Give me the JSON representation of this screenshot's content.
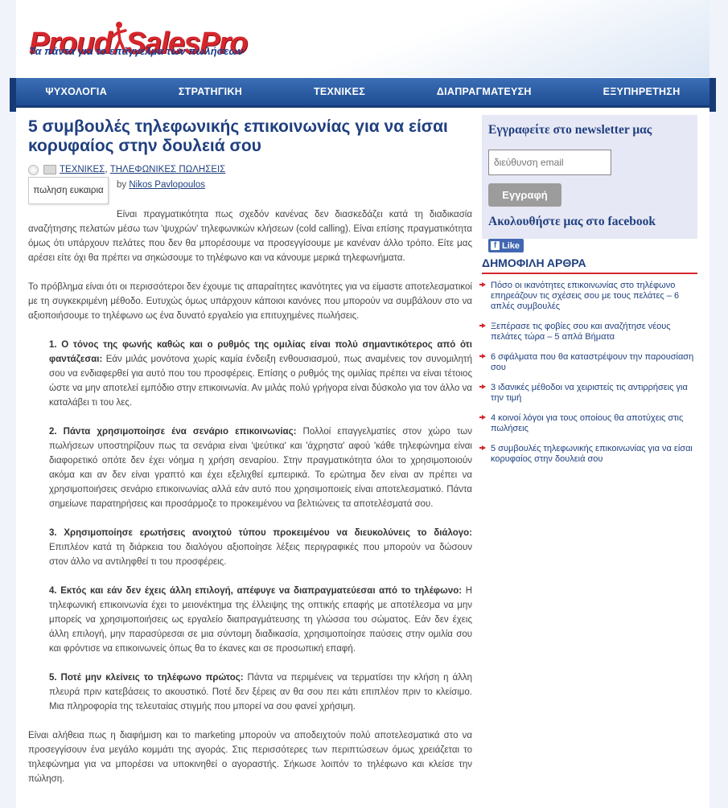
{
  "brand": {
    "word1": "Proud",
    "word2": "SalesPro",
    "tagline": "Τα πάντα για το επάγγελμα των πωλήσεων"
  },
  "nav": {
    "items": [
      "ΨΥΧΟΛΟΓΙΑ",
      "ΣΤΡΑΤΗΓΙΚΗ",
      "ΤΕΧΝΙΚΕΣ",
      "ΔΙΑΠΡΑΓΜΑΤΕΥΣΗ",
      "ΕΞΥΠΗΡΕΤΗΣΗ"
    ]
  },
  "post": {
    "title": "5 συμβουλές τηλεφωνικής επικοινωνίας για να είσαι κορυφαίος στην δουλειά σου",
    "categories": [
      "ΤΕΧΝΙΚΕΣ",
      "ΤΗΛΕΦΩΝΙΚΕΣ ΠΩΛΗΣΕΙΣ"
    ],
    "category_sep": ", ",
    "tag": "πωληση ευκαιρια",
    "by_label": "by",
    "author": "Nikos Pavlopoulos",
    "intro1": "Είναι πραγματικότητα πως σχεδόν κανένας δεν διασκεδάζει κατά τη διαδικασία αναζήτησης πελατών μέσω των 'ψυχρών' τηλεφωνικών κλήσεων (cold calling). Είναι επίσης πραγματικότητα όμως ότι υπάρχουν πελάτες που δεν θα μπορέσουμε να προσεγγίσουμε με κανέναν άλλο τρόπο. Είτε μας αρέσει είτε όχι θα πρέπει να σηκώσουμε το τηλέφωνο και να κάνουμε μερικά τηλεφωνήματα.",
    "intro2": "Το πρόβλημα είναι ότι οι περισσότεροι δεν έχουμε τις απαραίτητες ικανότητες για να είμαστε αποτελεσματικοί με τη συγκεκριμένη μέθοδο. Ευτυχώς όμως υπάρχουν κάποιοι κανόνες που μπορούν να συμβάλουν στο να αξιοποιήσουμε το τηλέφωνο ως ένα δυνατό εργαλείο για επιτυχημένες πωλήσεις.",
    "tips": [
      {
        "heading": "1. Ο τόνος της φωνής καθώς και ο ρυθμός της ομιλίας είναι πολύ σημαντικότερος από ότι φαντάζεσαι:",
        "text": " Εάν μιλάς μονότονα χωρίς καμία ένδειξη ενθουσιασμού, πως αναμένεις τον συνομιλητή σου να ενδιαφερθεί για αυτό που του προσφέρεις. Επίσης ο ρυθμός της ομιλίας πρέπει να είναι τέτοιος ώστε να μην αποτελεί εμπόδιο στην επικοινωνία. Αν μιλάς πολύ γρήγορα είναι δύσκολο για τον άλλο να καταλάβει τι του λες."
      },
      {
        "heading": "2. Πάντα χρησιμοποίησε ένα σενάριο επικοινωνίας:",
        "text": " Πολλοί επαγγελματίες στον χώρο των πωλήσεων υποστηρίζουν πως τα σενάρια είναι 'ψεύτικα' και 'άχρηστα' αφού 'κάθε τηλεφώνημα είναι διαφορετικό οπότε δεν έχει νόημα η χρήση σεναρίου. Στην πραγματικότητα όλοι το χρησιμοποιούν ακόμα και αν δεν είναι γραπτό και έχει εξελιχθεί εμπειρικά. Το ερώτημα δεν είναι αν πρέπει να χρησιμοποιήσεις σενάριο επικοινωνίας αλλά εάν αυτό που χρησιμοποιείς είναι αποτελεσματικό. Πάντα σημείωνε παρατηρήσεις και προσάρμοζε το προκειμένου να βελτιώνεις τα αποτελέσματά σου."
      },
      {
        "heading": "3.  Χρησιμοποίησε ερωτήσεις ανοιχτού τύπου προκειμένου να διευκολύνεις το διάλογο:",
        "text": " Επιπλέον κατά τη διάρκεια του διαλόγου αξιοποίησε λέξεις περιγραφικές που μπορούν να δώσουν στον άλλο να αντιληφθεί τι του προσφέρεις."
      },
      {
        "heading": "4. Εκτός και εάν δεν έχεις άλλη επιλογή, απέφυγε να διαπραγματεύεσαι από το τηλέφωνο:",
        "text": "  Η τηλεφωνική επικοινωνία έχει το μειονέκτημα της έλλειψης της οπτικής επαφής με αποτέλεσμα να μην μπορείς να χρησιμοποιήσεις ως εργαλείο διαπραγμάτευσης τη γλώσσα του σώματος. Εάν δεν έχεις άλλη επιλογή,  μην παρασύρεσαι σε μια σύντομη διαδικασία, χρησιμοποίησε παύσεις στην ομιλία σου και φρόντισε να επικοινωνείς όπως θα το έκανες και σε προσωπική επαφή."
      },
      {
        "heading": "5. Ποτέ μην κλείνεις το τηλέφωνο πρώτος:",
        "text": " Πάντα να περιμένεις να τερματίσει την κλήση η άλλη πλευρά πριν κατεβάσεις το ακουστικό. Ποτέ δεν ξέρεις αν θα σου πει κάτι επιπλέον πριν το κλείσιμο. Μια πληροφορία της τελευταίας στιγμής που μπορεί να σου φανεί χρήσιμη."
      }
    ],
    "outro": "Είναι αλήθεια πως η διαφήμιση και το marketing μπορούν να αποδειχτούν πολύ αποτελεσματικά στο να προσεγγίσουν ένα μεγάλο κομμάτι της αγοράς. Στις περισσότερες των περιπτώσεων όμως χρειάζεται το τηλεφώνημα για να μπορέσει να υποκινηθεί ο αγοραστής. Σήκωσε λοιπόν το τηλέφωνο και κλείσε την πώληση."
  },
  "sidebar": {
    "newsletter_title": "Εγγραφείτε στο newsletter μας",
    "email_placeholder": "διεύθυνση email",
    "subscribe_label": "Εγγραφή",
    "facebook_title": "Ακολουθήστε μας στο facebook",
    "like_label": "Like",
    "popular_title": "ΔΗΜΟΦΙΛΗ ΑΡΘΡΑ",
    "popular": [
      "Πόσο οι ικανότητες επικοινωνίας στο τηλέφωνο επηρεάζουν τις σχέσεις σου με τους πελάτες – 6 απλές συμβουλές",
      "Ξεπέρασε τις φοβίες σου και αναζήτησε νέους πελάτες τώρα – 5 απλά Βήματα",
      "6 σφάλματα που θα καταστρέψουν την παρουσίαση σου",
      "3 ιδανικές μέθοδοι να χειριστείς τις αντιρρήσεις για την τιμή",
      "4 κοινοί λόγοι για τους οποίους θα αποτύχεις στις πωλήσεις",
      "5 συμβουλές τηλεφωνικής επικοινωνίας για να είσαι κορυφαίος στην δουλειά σου"
    ]
  },
  "colors": {
    "brand_red": "#d6262c",
    "brand_blue": "#1f3f7f",
    "nav_blue": "#2a5ca3",
    "panel_bg": "#e7e8f5"
  }
}
